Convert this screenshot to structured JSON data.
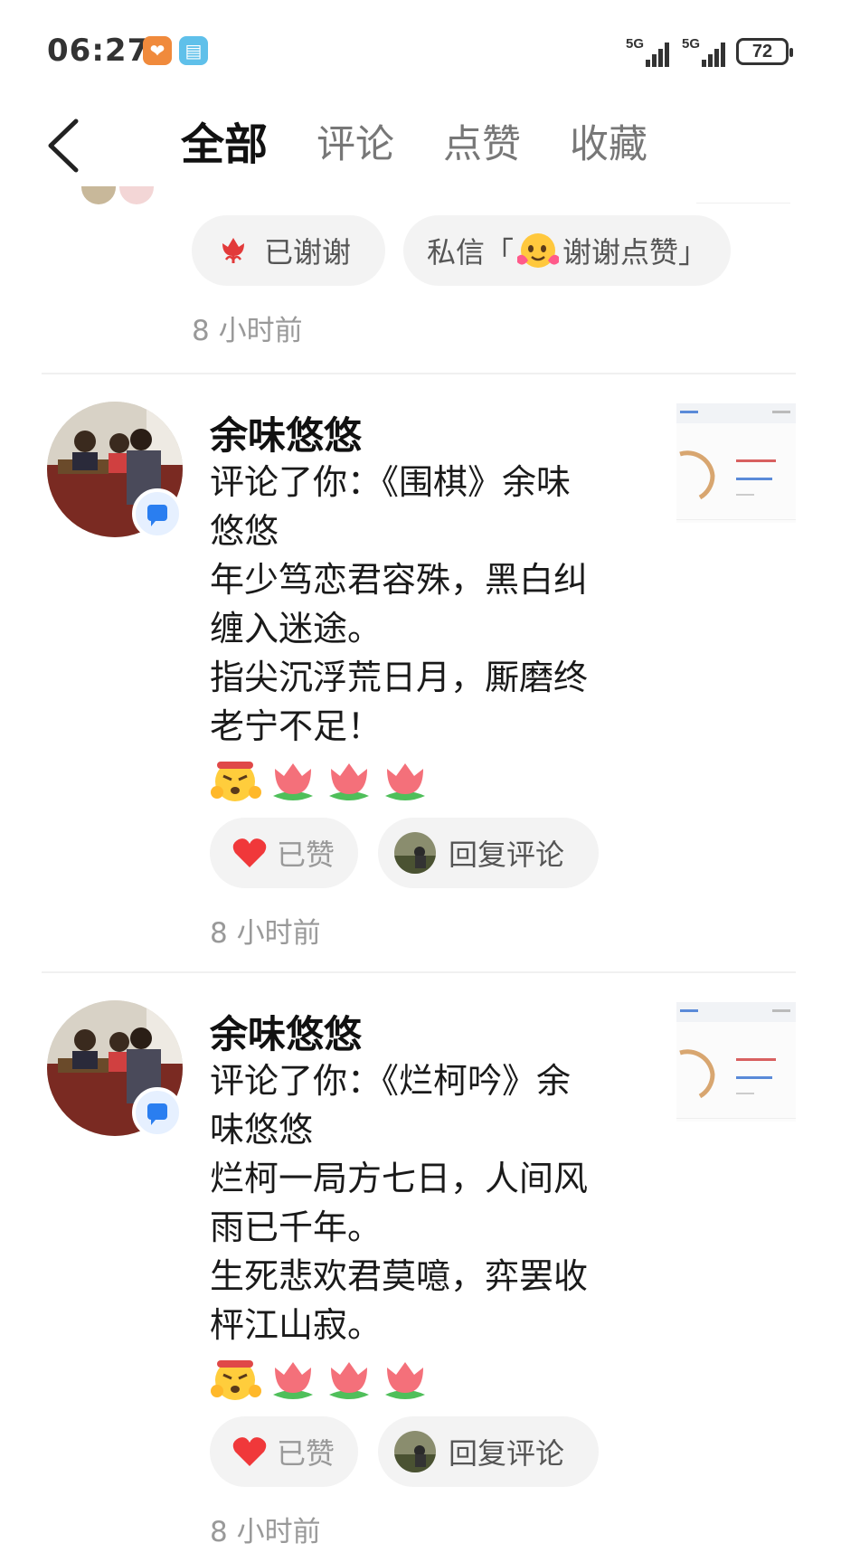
{
  "status_bar": {
    "time": "06:27",
    "network_1": "5G",
    "network_2": "5G",
    "battery": "72"
  },
  "nav": {
    "tabs": [
      {
        "label": "全部",
        "active": true
      },
      {
        "label": "评论",
        "active": false
      },
      {
        "label": "点赞",
        "active": false
      },
      {
        "label": "收藏",
        "active": false
      }
    ]
  },
  "top_item": {
    "thanked_label": "已谢谢",
    "dm_prefix": "私信「",
    "dm_text": "谢谢点赞」",
    "time": "8 小时前"
  },
  "notifications": [
    {
      "username": "余味悠悠",
      "comment_lines": [
        "评论了你：《围棋》余味",
        "悠悠",
        "年少笃恋君容殊，黑白纠",
        "缠入迷途。",
        "指尖沉浮荒日月，厮磨终",
        "老宁不足！"
      ],
      "liked_label": "已赞",
      "reply_label": "回复评论",
      "time": "8 小时前"
    },
    {
      "username": "余味悠悠",
      "comment_lines": [
        "评论了你：《烂柯吟》余",
        "味悠悠",
        "烂柯一局方七日，人间风",
        "雨已千年。",
        "生死悲欢君莫噫，弈罢收",
        "枰江山寂。"
      ],
      "liked_label": "已赞",
      "reply_label": "回复评论",
      "time": "8 小时前"
    }
  ],
  "colors": {
    "accent_red": "#f0383a",
    "badge_blue": "#2a7ef0",
    "pill_bg": "#f3f3f3",
    "muted_text": "#999999"
  }
}
